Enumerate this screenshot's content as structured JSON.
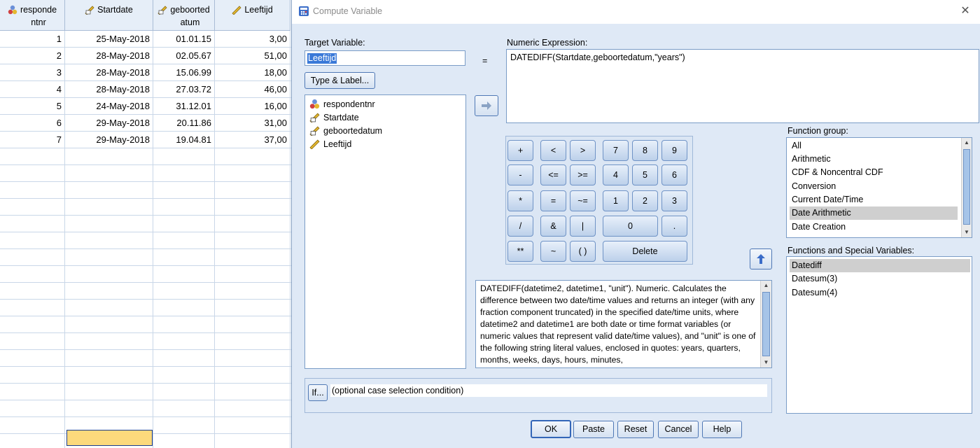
{
  "grid": {
    "headers": [
      {
        "line1": "responde",
        "line2": "ntnr"
      },
      {
        "line1": "Startdate",
        "line2": ""
      },
      {
        "line1": "geboorted",
        "line2": "atum"
      },
      {
        "line1": "Leeftijd",
        "line2": ""
      }
    ],
    "rows": [
      {
        "n": "1",
        "start": "25-May-2018",
        "geb": "01.01.15",
        "leef": "3,00"
      },
      {
        "n": "2",
        "start": "28-May-2018",
        "geb": "02.05.67",
        "leef": "51,00"
      },
      {
        "n": "3",
        "start": "28-May-2018",
        "geb": "15.06.99",
        "leef": "18,00"
      },
      {
        "n": "4",
        "start": "28-May-2018",
        "geb": "27.03.72",
        "leef": "46,00"
      },
      {
        "n": "5",
        "start": "24-May-2018",
        "geb": "31.12.01",
        "leef": "16,00"
      },
      {
        "n": "6",
        "start": "29-May-2018",
        "geb": "20.11.86",
        "leef": "31,00"
      },
      {
        "n": "7",
        "start": "29-May-2018",
        "geb": "19.04.81",
        "leef": "37,00"
      }
    ]
  },
  "dialog": {
    "title": "Compute Variable",
    "close_glyph": "✕",
    "target_label": "Target Variable:",
    "target_value": "Leeftijd",
    "type_label_button": "Type & Label...",
    "equals": "=",
    "numeric_label": "Numeric Expression:",
    "numeric_value": "DATEDIFF(Startdate,geboortedatum,\"years\")",
    "variables": [
      "respondentnr",
      "Startdate",
      "geboortedatum",
      "Leeftijd"
    ],
    "keys": {
      "plus": "+",
      "lt": "<",
      "gt": ">",
      "k7": "7",
      "k8": "8",
      "k9": "9",
      "minus": "-",
      "le": "<=",
      "ge": ">=",
      "k4": "4",
      "k5": "5",
      "k6": "6",
      "mul": "*",
      "eq": "=",
      "ne": "~=",
      "k1": "1",
      "k2": "2",
      "k3": "3",
      "div": "/",
      "and": "&",
      "or": "|",
      "k0": "0",
      "dot": ".",
      "pow": "**",
      "not": "~",
      "paren": "( )",
      "del": "Delete"
    },
    "description": "DATEDIFF(datetime2, datetime1, \"unit\"). Numeric. Calculates the difference between two date/time values and returns an integer (with any fraction component truncated) in the specified date/time units, where datetime2 and datetime1 are both date or time format variables (or numeric values that represent valid date/time values), and \"unit\" is one of the following string literal values, enclosed in quotes: years, quarters, months, weeks, days, hours, minutes,",
    "function_group_label": "Function group:",
    "function_groups": [
      "All",
      "Arithmetic",
      "CDF & Noncentral CDF",
      "Conversion",
      "Current Date/Time",
      "Date Arithmetic",
      "Date Creation"
    ],
    "functions_label": "Functions and Special Variables:",
    "functions": [
      "Datediff",
      "Datesum(3)",
      "Datesum(4)"
    ],
    "if_button": "If...",
    "if_text": "(optional case selection condition)",
    "buttons": {
      "ok": "OK",
      "paste": "Paste",
      "reset": "Reset",
      "cancel": "Cancel",
      "help": "Help"
    }
  }
}
